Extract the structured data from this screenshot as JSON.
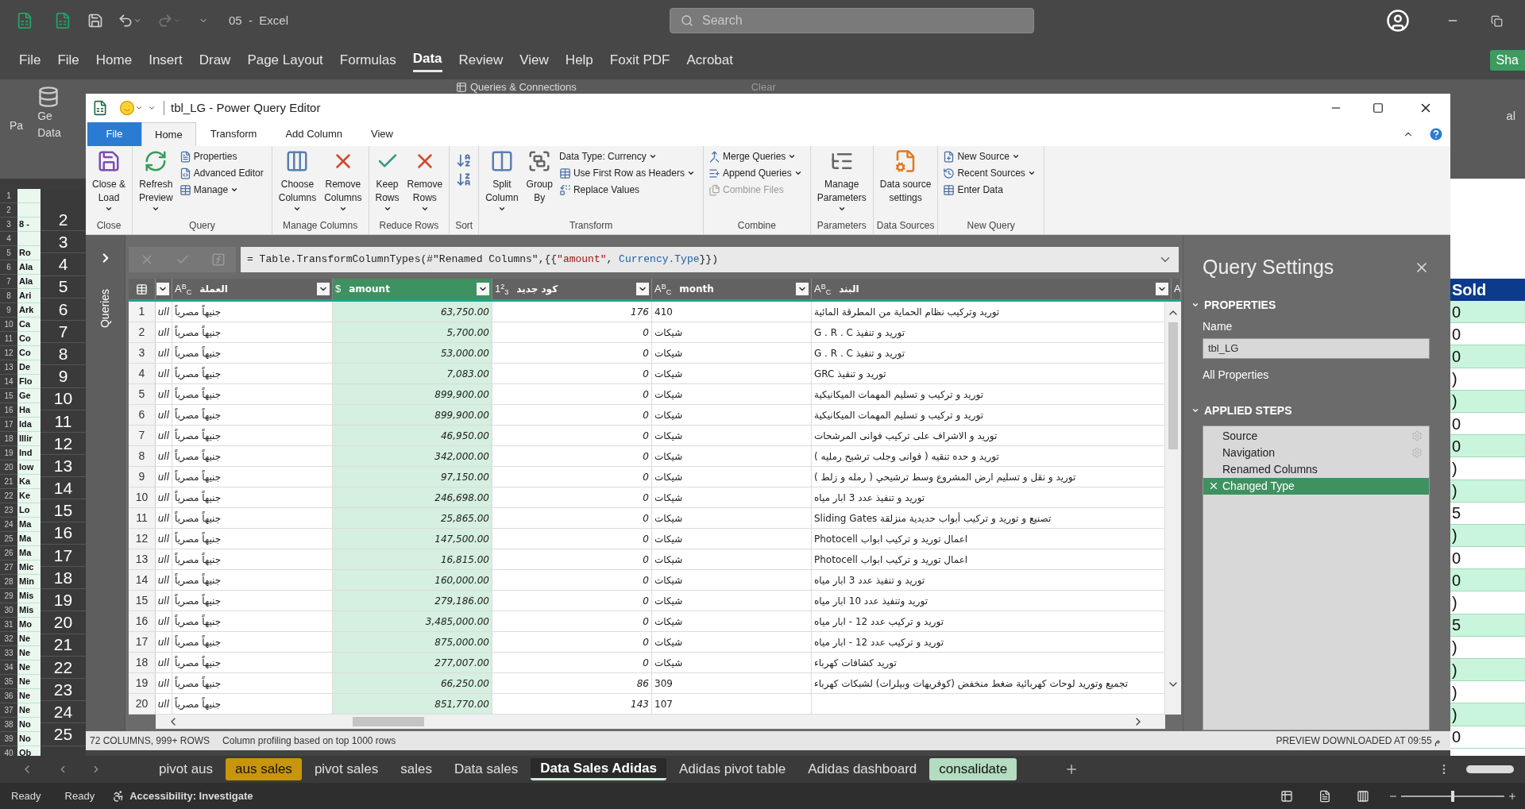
{
  "excel": {
    "title": "05  -  Excel",
    "search": {
      "placeholder": "Search"
    },
    "menu": [
      {
        "label": "File",
        "selected": false
      },
      {
        "label": "File",
        "selected": false
      },
      {
        "label": "Home",
        "selected": false
      },
      {
        "label": "Insert",
        "selected": false
      },
      {
        "label": "Draw",
        "selected": false
      },
      {
        "label": "Page Layout",
        "selected": false
      },
      {
        "label": "Formulas",
        "selected": false
      },
      {
        "label": "Data",
        "selected": true
      },
      {
        "label": "Review",
        "selected": false
      },
      {
        "label": "View",
        "selected": false
      },
      {
        "label": "Help",
        "selected": false
      },
      {
        "label": "Foxit PDF",
        "selected": false
      },
      {
        "label": "Acrobat",
        "selected": false
      }
    ],
    "share": "Sha",
    "ribbon_fragments": {
      "queries": "Queries & Connections",
      "clear": "Clear",
      "left": [
        "Pa",
        "Ge",
        "Data"
      ],
      "right": "al"
    },
    "rows": [
      {
        "number": "1"
      },
      {
        "number": "2"
      },
      {
        "number": "3",
        "cell": "8 -"
      },
      {
        "number": "4"
      },
      {
        "number": "5",
        "cell": "Ro"
      },
      {
        "number": "6",
        "cell": "Ala"
      },
      {
        "number": "7",
        "cell": "Ala"
      },
      {
        "number": "8",
        "cell": "Ari"
      },
      {
        "number": "9",
        "cell": "Ark"
      },
      {
        "number": "10",
        "cell": "Ca"
      },
      {
        "number": "11",
        "cell": "Co"
      },
      {
        "number": "12",
        "cell": "Co"
      },
      {
        "number": "13",
        "cell": "De"
      },
      {
        "number": "14",
        "cell": "Flo"
      },
      {
        "number": "15",
        "cell": "Ge"
      },
      {
        "number": "16",
        "cell": "Ha"
      },
      {
        "number": "17",
        "cell": "Ida"
      },
      {
        "number": "18",
        "cell": "Illir"
      },
      {
        "number": "19",
        "cell": "Ind"
      },
      {
        "number": "20",
        "cell": "low"
      },
      {
        "number": "21",
        "cell": "Ka"
      },
      {
        "number": "22",
        "cell": "Ke"
      },
      {
        "number": "23",
        "cell": "Lo"
      },
      {
        "number": "24",
        "cell": "Ma"
      },
      {
        "number": "25",
        "cell": "Ma"
      },
      {
        "number": "26",
        "cell": "Ma"
      },
      {
        "number": "27",
        "cell": "Mic"
      },
      {
        "number": "28",
        "cell": "Min"
      },
      {
        "number": "29",
        "cell": "Mis"
      },
      {
        "number": "30",
        "cell": "Mis"
      },
      {
        "number": "31",
        "cell": "Mo"
      },
      {
        "number": "32",
        "cell": "Ne"
      },
      {
        "number": "33",
        "cell": "Ne"
      },
      {
        "number": "34",
        "cell": "Ne"
      },
      {
        "number": "35",
        "cell": "Ne"
      },
      {
        "number": "36",
        "cell": "Ne"
      },
      {
        "number": "37",
        "cell": "Ne"
      },
      {
        "number": "38",
        "cell": "No"
      },
      {
        "number": "39",
        "cell": "No"
      },
      {
        "number": "40",
        "cell": "Ob"
      }
    ],
    "zoomed_rows": [
      "2",
      "3",
      "4",
      "5",
      "6",
      "7",
      "8",
      "9",
      "10",
      "11",
      "12",
      "13",
      "14",
      "15",
      "16",
      "17",
      "18",
      "19",
      "20",
      "21",
      "22",
      "23",
      "24",
      "25"
    ],
    "right_column": {
      "header": "Sold",
      "values": [
        "0",
        "0",
        "0",
        ")",
        ")",
        "0",
        "0",
        ")",
        ")",
        "5",
        ")",
        "0",
        "0",
        ")",
        "5",
        ")",
        ")",
        ")",
        ")",
        "0"
      ]
    },
    "sheet_tabs": [
      {
        "label": "pivot aus",
        "selected": false
      },
      {
        "label": "aus sales",
        "selected": false,
        "color": "#c8960c"
      },
      {
        "label": "pivot sales",
        "selected": false
      },
      {
        "label": "sales",
        "selected": false
      },
      {
        "label": "Data sales",
        "selected": false
      },
      {
        "label": "Data Sales Adidas",
        "selected": true
      },
      {
        "label": "Adidas pivot table",
        "selected": false
      },
      {
        "label": "Adidas dashboard",
        "selected": false
      },
      {
        "label": "consalidate",
        "selected": false,
        "color": "#b4dcc0"
      }
    ],
    "status": {
      "ready": [
        "Ready",
        "Ready"
      ],
      "accessibility": "Accessibility: Investigate",
      "zoom": {
        "level": 0.5
      }
    }
  },
  "editor": {
    "title": "tbl_LG - Power Query Editor",
    "tabs": [
      {
        "label": "File",
        "kind": "file",
        "selected": false
      },
      {
        "label": "Home",
        "kind": "tab",
        "selected": true
      },
      {
        "label": "Transform",
        "kind": "tab",
        "selected": false
      },
      {
        "label": "Add Column",
        "kind": "tab",
        "selected": false
      },
      {
        "label": "View",
        "kind": "tab",
        "selected": false
      }
    ],
    "ribbon": [
      {
        "label": "Close",
        "kind": "buttons",
        "large": [
          {
            "lines": [
              "Close &",
              "Load"
            ],
            "caret": true
          }
        ]
      },
      {
        "label": "Query",
        "kind": "buttons",
        "large": [
          {
            "lines": [
              "Refresh",
              "Preview"
            ],
            "caret": true
          }
        ],
        "small": [
          {
            "label": "Properties",
            "caret": false,
            "disabled": false
          },
          {
            "label": "Advanced Editor",
            "caret": false,
            "disabled": false
          },
          {
            "label": "Manage",
            "caret": true,
            "disabled": false
          }
        ]
      },
      {
        "label": "Manage Columns",
        "kind": "buttons",
        "large": [
          {
            "lines": [
              "Choose",
              "Columns"
            ],
            "caret": true
          },
          {
            "lines": [
              "Remove",
              "Columns"
            ],
            "caret": true
          }
        ]
      },
      {
        "label": "Reduce Rows",
        "kind": "buttons",
        "large": [
          {
            "lines": [
              "Keep",
              "Rows"
            ],
            "caret": true
          },
          {
            "lines": [
              "Remove",
              "Rows"
            ],
            "caret": true
          }
        ]
      },
      {
        "label": "Sort",
        "kind": "sort"
      },
      {
        "label": "Transform",
        "kind": "buttons",
        "large": [
          {
            "lines": [
              "Split",
              "Column"
            ],
            "caret": true
          },
          {
            "lines": [
              "Group",
              "By"
            ],
            "caret": false
          }
        ],
        "small": [
          {
            "label": "Data Type: Currency",
            "caret": true,
            "disabled": false
          },
          {
            "label": "Use First Row as Headers",
            "caret": true,
            "disabled": false
          },
          {
            "label": "Replace Values",
            "caret": false,
            "disabled": false
          }
        ]
      },
      {
        "label": "Combine",
        "kind": "buttons",
        "small": [
          {
            "label": "Merge Queries",
            "caret": true,
            "disabled": false
          },
          {
            "label": "Append Queries",
            "caret": true,
            "disabled": false
          },
          {
            "label": "Combine Files",
            "caret": false,
            "disabled": true
          }
        ]
      },
      {
        "label": "Parameters",
        "kind": "buttons",
        "large": [
          {
            "lines": [
              "Manage",
              "Parameters"
            ],
            "caret": true
          }
        ]
      },
      {
        "label": "Data Sources",
        "kind": "buttons",
        "large": [
          {
            "lines": [
              "Data source",
              "settings"
            ],
            "caret": false
          }
        ]
      },
      {
        "label": "New Query",
        "kind": "buttons",
        "small": [
          {
            "label": "New Source",
            "caret": true,
            "disabled": false
          },
          {
            "label": "Recent Sources",
            "caret": true,
            "disabled": false
          },
          {
            "label": "Enter Data",
            "caret": false,
            "disabled": false
          }
        ]
      }
    ],
    "queries_label": "Queries",
    "formula": [
      {
        "text": "= Table.TransformColumnTypes(#\"Renamed Columns\",{{",
        "kind": "plain"
      },
      {
        "text": "\"amount\"",
        "kind": "string"
      },
      {
        "text": ", ",
        "kind": "plain"
      },
      {
        "text": "Currency.Type",
        "kind": "keyword"
      },
      {
        "text": "}})",
        "kind": "plain"
      }
    ],
    "columns": [
      {
        "selected": false
      },
      {
        "type": "A$^{B}$$_{C}$",
        "label": "العملة",
        "selected": false
      },
      {
        "type": "$",
        "label": "amount",
        "selected": true
      },
      {
        "type": "1$^{2}$$_{3}$",
        "label": "كود جديد",
        "selected": false
      },
      {
        "type": "A$^{B}$$_{C}$",
        "label": "month",
        "selected": false
      },
      {
        "type": "A$^{B}$$_{C}$",
        "label": "البند",
        "selected": false
      },
      {
        "type": "A",
        "selected": false
      }
    ],
    "rows": [
      {
        "index": "1",
        "cells": [
          "ull",
          "جنيهاً مصرياً",
          "63,750.00",
          "176",
          "410",
          "توريد وتركيب نظام الحماية من المطرقة المائية"
        ]
      },
      {
        "index": "2",
        "cells": [
          "ull",
          "جنيهاً مصرياً",
          "5,700.00",
          "0",
          "شيكات",
          "توريد و تنفيذ G . R . C"
        ]
      },
      {
        "index": "3",
        "cells": [
          "ull",
          "جنيهاً مصرياً",
          "53,000.00",
          "0",
          "شيكات",
          "توريد و تنفيذ G . R . C"
        ]
      },
      {
        "index": "4",
        "cells": [
          "ull",
          "جنيهاً مصرياً",
          "7,083.00",
          "0",
          "شيكات",
          "توريد و تنفيذ GRC"
        ]
      },
      {
        "index": "5",
        "cells": [
          "ull",
          "جنيهاً مصرياً",
          "899,900.00",
          "0",
          "شيكات",
          "توريد و تركيب و تسليم المهمات الميكانيكية"
        ]
      },
      {
        "index": "6",
        "cells": [
          "ull",
          "جنيهاً مصرياً",
          "899,900.00",
          "0",
          "شيكات",
          "توريد و تركيب و تسليم المهمات الميكانيكية"
        ]
      },
      {
        "index": "7",
        "cells": [
          "ull",
          "جنيهاً مصرياً",
          "46,950.00",
          "0",
          "شيكات",
          "توريد و الاشراف على تركيب فوانى المرشحات"
        ]
      },
      {
        "index": "8",
        "cells": [
          "ull",
          "جنيهاً مصرياً",
          "342,000.00",
          "0",
          "شيكات",
          "توريد و حده تنقيه ( فوانى وجلب ترشيح رمليه )"
        ]
      },
      {
        "index": "9",
        "cells": [
          "ull",
          "جنيهاً مصرياً",
          "97,150.00",
          "0",
          "شيكات",
          "توريد و نقل و تسليم ارض المشروع وسط ترشيحي ( رمله و زلط )"
        ]
      },
      {
        "index": "10",
        "cells": [
          "ull",
          "جنيهاً مصرياً",
          "246,698.00",
          "0",
          "شيكات",
          "توريد و تنفيذ عدد 3 ابار مياه"
        ]
      },
      {
        "index": "11",
        "cells": [
          "ull",
          "جنيهاً مصرياً",
          "25,865.00",
          "0",
          "شيكات",
          "تصنيع و توريد و تركيب أبواب حديدية منزلقة Sliding Gates"
        ]
      },
      {
        "index": "12",
        "cells": [
          "ull",
          "جنيهاً مصرياً",
          "147,500.00",
          "0",
          "شيكات",
          "اعمال توريد و تركيب ابواب Photocell"
        ]
      },
      {
        "index": "13",
        "cells": [
          "ull",
          "جنيهاً مصرياً",
          "16,815.00",
          "0",
          "شيكات",
          "اعمال توريد و تركيب ابواب Photocell"
        ]
      },
      {
        "index": "14",
        "cells": [
          "ull",
          "جنيهاً مصرياً",
          "160,000.00",
          "0",
          "شيكات",
          "توريد و تنفيذ عدد 3 ابار مياه"
        ]
      },
      {
        "index": "15",
        "cells": [
          "ull",
          "جنيهاً مصرياً",
          "279,186.00",
          "0",
          "شيكات",
          "توريد وتنفيذ عدد 10 ابار مياه"
        ]
      },
      {
        "index": "16",
        "cells": [
          "ull",
          "جنيهاً مصرياً",
          "3,485,000.00",
          "0",
          "شيكات",
          "توريد و تركيب عدد 12 - ابار مياه"
        ]
      },
      {
        "index": "17",
        "cells": [
          "ull",
          "جنيهاً مصرياً",
          "875,000.00",
          "0",
          "شيكات",
          "توريد و تركيب عدد 12 - ابار مياه"
        ]
      },
      {
        "index": "18",
        "cells": [
          "ull",
          "جنيهاً مصرياً",
          "277,007.00",
          "0",
          "شيكات",
          "توريد كشافات كهرباء"
        ]
      },
      {
        "index": "19",
        "cells": [
          "ull",
          "جنيهاً مصرياً",
          "66,250.00",
          "86",
          "309",
          "تجميع وتوريد لوحات كهربائية ضغط منخفض (كوفريهات وبيلرات) لشبكات كهرباء"
        ]
      },
      {
        "index": "20",
        "cells": [
          "ull",
          "جنيهاً مصرياً",
          "851,770.00",
          "143",
          "107"
        ]
      }
    ],
    "settings": {
      "title": "Query Settings",
      "properties_heading": "PROPERTIES",
      "name_label": "Name",
      "name_value": "tbl_LG",
      "all_properties": "All Properties",
      "steps_heading": "APPLIED STEPS",
      "steps": [
        {
          "label": "Source",
          "has_settings": true,
          "selected": false
        },
        {
          "label": "Navigation",
          "has_settings": true,
          "selected": false
        },
        {
          "label": "Renamed Columns",
          "has_settings": false,
          "selected": false
        },
        {
          "label": "Changed Type",
          "has_settings": false,
          "selected": true
        }
      ]
    },
    "status": {
      "columns": "72 COLUMNS, 999+ ROWS",
      "profiling": "Column profiling based on top 1000 rows",
      "preview": "PREVIEW DOWNLOADED AT 09:55 م"
    }
  }
}
